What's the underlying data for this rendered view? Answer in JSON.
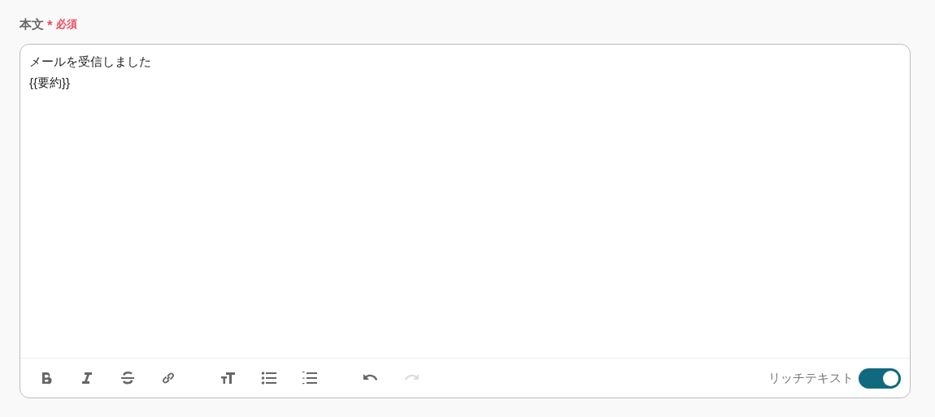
{
  "field": {
    "label": "本文",
    "required_mark": "*",
    "required_badge": "必須"
  },
  "editor": {
    "lines": [
      "メールを受信しました",
      "{{要約}}"
    ]
  },
  "toolbar": {
    "groups": [
      [
        {
          "kind": "bold",
          "disabled": false
        },
        {
          "kind": "italic",
          "disabled": false
        },
        {
          "kind": "strike",
          "disabled": false
        },
        {
          "kind": "link",
          "disabled": false
        }
      ],
      [
        {
          "kind": "heading",
          "disabled": false
        },
        {
          "kind": "bullets",
          "disabled": false
        },
        {
          "kind": "numbers",
          "disabled": false
        }
      ],
      [
        {
          "kind": "undo",
          "disabled": false
        },
        {
          "kind": "redo",
          "disabled": true
        }
      ]
    ]
  },
  "rich_text": {
    "label": "リッチテキスト",
    "on": true
  }
}
